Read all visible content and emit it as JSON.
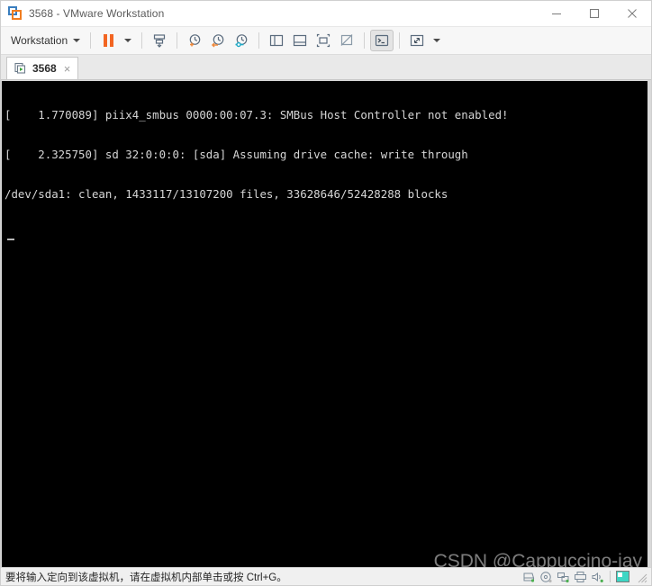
{
  "window": {
    "title": "3568 - VMware Workstation",
    "app_icon": "vmware-logo-icon",
    "minimize_label": "−",
    "maximize_label": "□",
    "close_label": "×"
  },
  "toolbar": {
    "menu_label": "Workstation",
    "menu_caret": "▾",
    "buttons": [
      {
        "name": "pause-vm-button",
        "icon": "pause-icon",
        "tooltip": "Suspend this virtual machine"
      },
      {
        "name": "pause-dropdown-button",
        "icon": "chevron-down-icon",
        "tooltip": "Power options"
      },
      {
        "name": "send-ctrl-alt-del-button",
        "icon": "send-key-icon",
        "tooltip": "Send Ctrl+Alt+Delete"
      },
      {
        "name": "take-snapshot-button",
        "icon": "clock-plus-icon",
        "tooltip": "Take a snapshot"
      },
      {
        "name": "revert-snapshot-button",
        "icon": "clock-back-icon",
        "tooltip": "Revert to snapshot"
      },
      {
        "name": "snapshot-manager-button",
        "icon": "clock-manager-icon",
        "tooltip": "Manage snapshots"
      },
      {
        "name": "show-library-button",
        "icon": "library-panel-icon",
        "tooltip": "Show or hide the library"
      },
      {
        "name": "show-thumbnail-bar-button",
        "icon": "thumbnail-bar-icon",
        "tooltip": "Show or hide thumbnails"
      },
      {
        "name": "full-screen-button",
        "icon": "fullscreen-icon",
        "tooltip": "Enter full screen mode"
      },
      {
        "name": "unity-mode-button",
        "icon": "unity-icon",
        "tooltip": "Enter Unity mode"
      },
      {
        "name": "console-view-button",
        "icon": "console-prompt-icon",
        "tooltip": "Console view",
        "active": true
      },
      {
        "name": "stretch-view-button",
        "icon": "stretch-arrows-icon",
        "tooltip": "Stretch guest display"
      },
      {
        "name": "stretch-dropdown-button",
        "icon": "chevron-down-icon",
        "tooltip": "Display options"
      }
    ]
  },
  "tabs": [
    {
      "label": "3568",
      "icon": "vm-running-icon",
      "close_label": "×",
      "active": true
    }
  ],
  "console": {
    "lines": [
      "[    1.770089] piix4_smbus 0000:00:07.3: SMBus Host Controller not enabled!",
      "[    2.325750] sd 32:0:0:0: [sda] Assuming drive cache: write through",
      "/dev/sda1: clean, 1433117/13107200 files, 33628646/52428288 blocks"
    ],
    "cursor": "_",
    "background_color": "#000000",
    "text_color": "#d6d6d6"
  },
  "watermark": {
    "text": "CSDN @Cappuccino-jay"
  },
  "status_bar": {
    "message": "要将输入定向到该虚拟机，请在虚拟机内部单击或按 Ctrl+G。",
    "devices": [
      {
        "name": "status-hard-disk-icon",
        "icon": "hard-disk-icon"
      },
      {
        "name": "status-cd-dvd-icon",
        "icon": "cd-dvd-icon"
      },
      {
        "name": "status-network-icon",
        "icon": "network-adapter-icon"
      },
      {
        "name": "status-printer-icon",
        "icon": "printer-icon"
      },
      {
        "name": "status-sound-icon",
        "icon": "sound-card-icon"
      },
      {
        "name": "status-display-icon",
        "icon": "display-highlight-icon"
      }
    ],
    "resize_grip": "resize-grip-icon"
  },
  "colors": {
    "accent_orange": "#f26522",
    "logo_blue": "#3a7ebf",
    "console_bg": "#000000",
    "device_green": "#4caf50",
    "highlight_teal": "#3dd6c4"
  }
}
